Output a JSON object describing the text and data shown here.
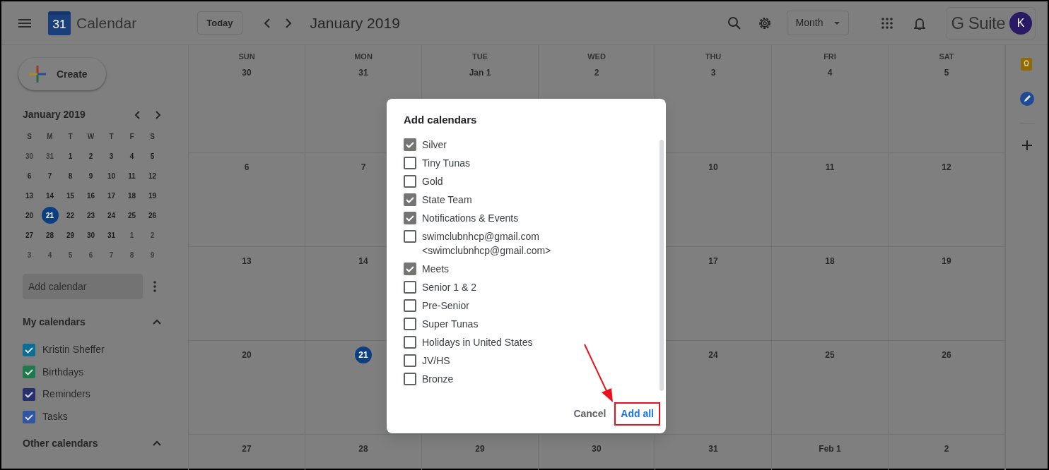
{
  "header": {
    "app_name": "Calendar",
    "logo_text": "31",
    "today_button": "Today",
    "title": "January 2019",
    "view_select": "Month",
    "brand": "G Suite",
    "avatar": "K"
  },
  "sidebar": {
    "create": "Create",
    "mini_calendar": {
      "title": "January 2019",
      "weekdays": [
        "S",
        "M",
        "T",
        "W",
        "T",
        "F",
        "S"
      ],
      "weeks": [
        [
          {
            "label": "30",
            "muted": true,
            "selected": false
          },
          {
            "label": "31",
            "muted": true,
            "selected": false
          },
          {
            "label": "1",
            "muted": false,
            "selected": false
          },
          {
            "label": "2",
            "muted": false,
            "selected": false
          },
          {
            "label": "3",
            "muted": false,
            "selected": false
          },
          {
            "label": "4",
            "muted": false,
            "selected": false
          },
          {
            "label": "5",
            "muted": false,
            "selected": false
          }
        ],
        [
          {
            "label": "6",
            "muted": false,
            "selected": false
          },
          {
            "label": "7",
            "muted": false,
            "selected": false
          },
          {
            "label": "8",
            "muted": false,
            "selected": false
          },
          {
            "label": "9",
            "muted": false,
            "selected": false
          },
          {
            "label": "10",
            "muted": false,
            "selected": false
          },
          {
            "label": "11",
            "muted": false,
            "selected": false
          },
          {
            "label": "12",
            "muted": false,
            "selected": false
          }
        ],
        [
          {
            "label": "13",
            "muted": false,
            "selected": false
          },
          {
            "label": "14",
            "muted": false,
            "selected": false
          },
          {
            "label": "15",
            "muted": false,
            "selected": false
          },
          {
            "label": "16",
            "muted": false,
            "selected": false
          },
          {
            "label": "17",
            "muted": false,
            "selected": false
          },
          {
            "label": "18",
            "muted": false,
            "selected": false
          },
          {
            "label": "19",
            "muted": false,
            "selected": false
          }
        ],
        [
          {
            "label": "20",
            "muted": false,
            "selected": false
          },
          {
            "label": "21",
            "muted": false,
            "selected": true
          },
          {
            "label": "22",
            "muted": false,
            "selected": false
          },
          {
            "label": "23",
            "muted": false,
            "selected": false
          },
          {
            "label": "24",
            "muted": false,
            "selected": false
          },
          {
            "label": "25",
            "muted": false,
            "selected": false
          },
          {
            "label": "26",
            "muted": false,
            "selected": false
          }
        ],
        [
          {
            "label": "27",
            "muted": false,
            "selected": false
          },
          {
            "label": "28",
            "muted": false,
            "selected": false
          },
          {
            "label": "29",
            "muted": false,
            "selected": false
          },
          {
            "label": "30",
            "muted": false,
            "selected": false
          },
          {
            "label": "31",
            "muted": false,
            "selected": false
          },
          {
            "label": "1",
            "muted": true,
            "selected": false
          },
          {
            "label": "2",
            "muted": true,
            "selected": false
          }
        ],
        [
          {
            "label": "3",
            "muted": true,
            "selected": false
          },
          {
            "label": "4",
            "muted": true,
            "selected": false
          },
          {
            "label": "5",
            "muted": true,
            "selected": false
          },
          {
            "label": "6",
            "muted": true,
            "selected": false
          },
          {
            "label": "7",
            "muted": true,
            "selected": false
          },
          {
            "label": "8",
            "muted": true,
            "selected": false
          },
          {
            "label": "9",
            "muted": true,
            "selected": false
          }
        ]
      ]
    },
    "add_calendar": {
      "placeholder": "Add calendar"
    },
    "sections": [
      {
        "title": "My calendars",
        "expanded": true,
        "items": [
          {
            "label": "Kristin Sheffer",
            "checked": true,
            "color": "#0b6e94"
          },
          {
            "label": "Birthdays",
            "checked": true,
            "color": "#1e7a4b"
          },
          {
            "label": "Reminders",
            "checked": true,
            "color": "#272f6e"
          },
          {
            "label": "Tasks",
            "checked": true,
            "color": "#2f56a3"
          }
        ]
      },
      {
        "title": "Other calendars",
        "expanded": true
      }
    ]
  },
  "calendar": {
    "weekdays": [
      "SUN",
      "MON",
      "TUE",
      "WED",
      "THU",
      "FRI",
      "SAT"
    ],
    "weeks": [
      {
        "leading": [
          {
            "label": "30",
            "today": false
          },
          {
            "label": "31",
            "today": false
          },
          {
            "label": "Jan 1",
            "today": false
          },
          {
            "label": "2",
            "today": false
          },
          {
            "label": "3",
            "today": false
          },
          {
            "label": "4",
            "today": false
          },
          {
            "label": "5",
            "today": false
          }
        ]
      },
      {
        "leading": [
          {
            "label": "6",
            "today": false
          },
          {
            "label": "7",
            "today": false
          }
        ],
        "trailing": [
          {
            "label": "10",
            "today": false
          },
          {
            "label": "11",
            "today": false
          },
          {
            "label": "12",
            "today": false
          }
        ]
      },
      {
        "leading": [
          {
            "label": "13",
            "today": false
          },
          {
            "label": "14",
            "today": false
          }
        ],
        "trailing": [
          {
            "label": "17",
            "today": false
          },
          {
            "label": "18",
            "today": false
          },
          {
            "label": "19",
            "today": false
          }
        ]
      },
      {
        "leading": [
          {
            "label": "20",
            "today": false
          },
          {
            "label": "21",
            "today": true
          }
        ],
        "trailing": [
          {
            "label": "24",
            "today": false
          },
          {
            "label": "25",
            "today": false
          },
          {
            "label": "26",
            "today": false
          }
        ]
      },
      {
        "leading": [
          {
            "label": "27",
            "today": false
          },
          {
            "label": "28",
            "today": false
          },
          {
            "label": "29",
            "today": false
          },
          {
            "label": "30",
            "today": false
          },
          {
            "label": "31",
            "today": false
          },
          {
            "label": "Feb 1",
            "today": false
          },
          {
            "label": "2",
            "today": false
          }
        ]
      }
    ]
  },
  "dialog": {
    "title": "Add calendars",
    "items": [
      {
        "label": "Silver",
        "checked": true
      },
      {
        "label": "Tiny Tunas",
        "checked": false
      },
      {
        "label": "Gold",
        "checked": false
      },
      {
        "label": "State Team",
        "checked": true
      },
      {
        "label": "Notifications & Events",
        "checked": true
      },
      {
        "label": "swimclubnhcp@gmail.com <swimclubnhcp@gmail.com>",
        "checked": false
      },
      {
        "label": "Meets",
        "checked": true
      },
      {
        "label": "Senior 1 & 2",
        "checked": false
      },
      {
        "label": "Pre-Senior",
        "checked": false
      },
      {
        "label": "Super Tunas",
        "checked": false
      },
      {
        "label": "Holidays in United States",
        "checked": false
      },
      {
        "label": "JV/HS",
        "checked": false
      },
      {
        "label": "Bronze",
        "checked": false
      }
    ],
    "buttons": [
      {
        "label": "Cancel",
        "kind": "text",
        "highlighted": false
      },
      {
        "label": "Add all",
        "kind": "primary",
        "highlighted": true
      }
    ]
  }
}
